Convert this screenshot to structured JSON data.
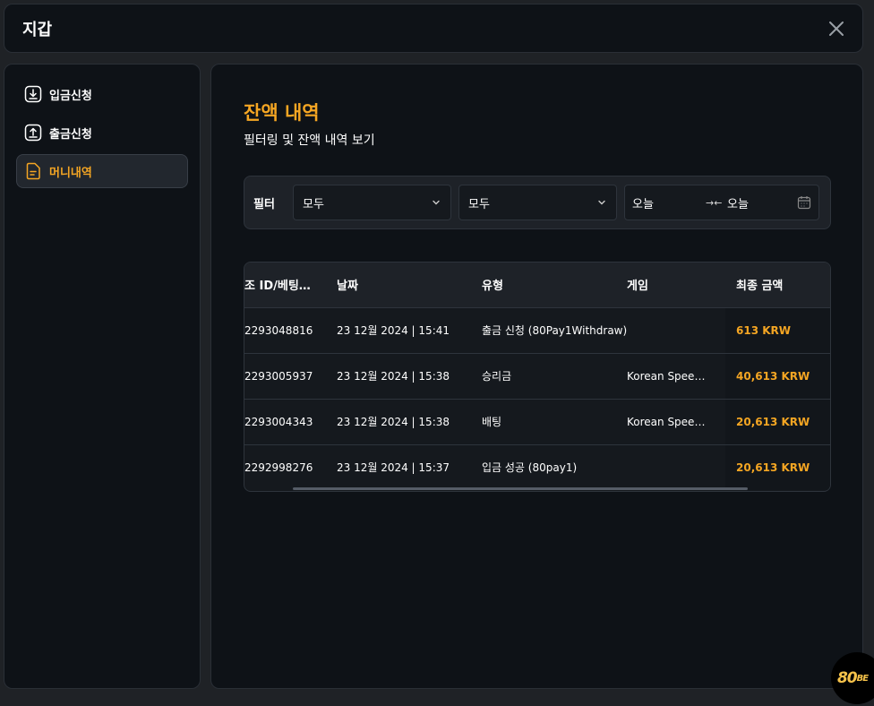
{
  "header": {
    "title": "지갑"
  },
  "sidebar": {
    "items": [
      {
        "label": "입금신청",
        "icon": "download-icon",
        "active": false
      },
      {
        "label": "출금신청",
        "icon": "upload-icon",
        "active": false
      },
      {
        "label": "머니내역",
        "icon": "document-icon",
        "active": true
      }
    ]
  },
  "main": {
    "title": "잔액 내역",
    "subtitle": "필터링 및 잔액 내역 보기"
  },
  "filter": {
    "label": "필터",
    "select1": "모두",
    "select2": "모두",
    "date_from": "오늘",
    "date_to": "오늘",
    "arrow": "→←"
  },
  "table": {
    "headers": [
      "조 ID/베팅…",
      "날짜",
      "유형",
      "게임",
      "최종 금액"
    ],
    "rows": [
      [
        "2293048816",
        "23 12월 2024 | 15:41",
        "출금 신청 (80Pay1Withdraw)",
        "",
        "613 KRW"
      ],
      [
        "2293005937",
        "23 12월 2024 | 15:38",
        "승리금",
        "Korean Spee…",
        "40,613 KRW"
      ],
      [
        "2293004343",
        "23 12월 2024 | 15:38",
        "배팅",
        "Korean Spee…",
        "20,613 KRW"
      ],
      [
        "2292998276",
        "23 12월 2024 | 15:37",
        "입금 성공 (80pay1)",
        "",
        "20,613 KRW"
      ]
    ]
  },
  "logo": {
    "main": "80",
    "suffix": "BE"
  },
  "colors": {
    "accent": "#f5a623",
    "panel": "#0e1217",
    "background": "#1f2226"
  }
}
